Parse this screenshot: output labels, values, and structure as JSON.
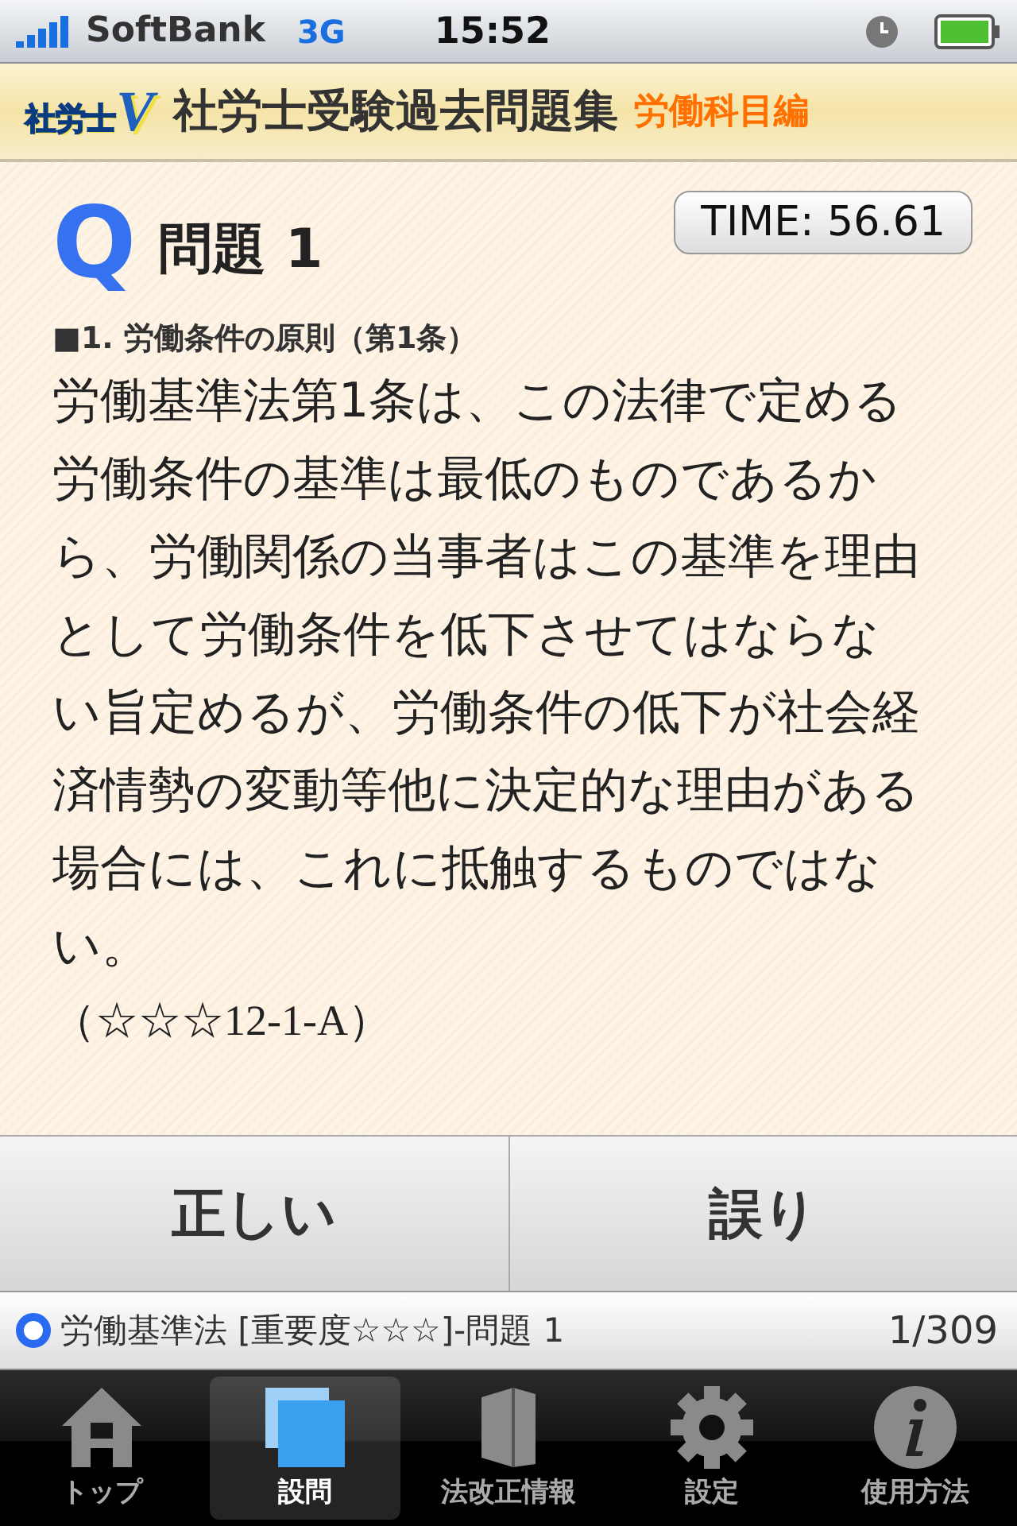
{
  "status_bar": {
    "carrier": "SoftBank",
    "network": "3G",
    "time": "15:52"
  },
  "header": {
    "logo_text": "社労士",
    "logo_mark": "V",
    "title": "社労士受験過去問題集",
    "subtitle": "労働科目編"
  },
  "question": {
    "mark": "Q",
    "title": "問題 1",
    "timer": "TIME: 56.61",
    "section": "■1. 労働条件の原則（第1条）",
    "body": "労働基準法第1条は、この法律で定める労働条件の基準は最低のものであるから、労働関係の当事者はこの基準を理由として労働条件を低下させてはならない旨定めるが、労働条件の低下が社会経済情勢の変動等他に決定的な理由がある場合には、これに抵触するものではない。",
    "reference": "（☆☆☆12-1-A）"
  },
  "answers": [
    "正しい",
    "誤り"
  ],
  "info_bar": {
    "label": "労働基準法 [重要度☆☆☆]-問題 1",
    "count": "1/309"
  },
  "tabs": [
    {
      "label": "トップ",
      "kind": "home",
      "selected": false
    },
    {
      "label": "設問",
      "kind": "pages",
      "selected": true
    },
    {
      "label": "法改正情報",
      "kind": "book",
      "selected": false
    },
    {
      "label": "設定",
      "kind": "gear",
      "selected": false
    },
    {
      "label": "使用方法",
      "kind": "info",
      "selected": false
    }
  ]
}
